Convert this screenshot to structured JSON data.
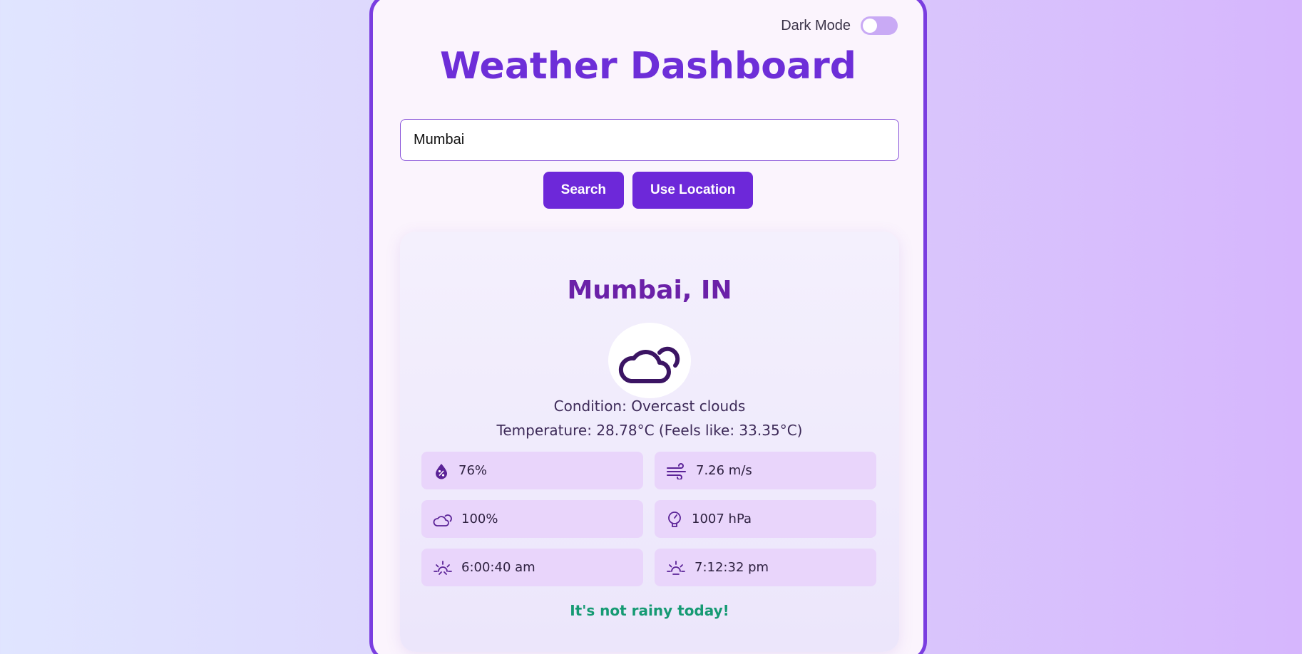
{
  "header": {
    "dark_mode_label": "Dark Mode",
    "dark_mode_on": false,
    "title": "Weather Dashboard"
  },
  "search": {
    "value": "Mumbai",
    "search_button": "Search",
    "location_button": "Use Location"
  },
  "weather": {
    "city": "Mumbai, IN",
    "condition_icon": "cloud-icon",
    "condition": "Condition: Overcast clouds",
    "temperature": "Temperature: 28.78°C (Feels like: 33.35°C)",
    "stats": {
      "humidity": {
        "icon": "humidity-drop-icon",
        "value": "76%"
      },
      "wind": {
        "icon": "wind-icon",
        "value": "7.26 m/s"
      },
      "clouds": {
        "icon": "cloud-icon",
        "value": "100%"
      },
      "pressure": {
        "icon": "pressure-gauge-icon",
        "value": "1007 hPa"
      },
      "sunrise": {
        "icon": "sunrise-icon",
        "value": "6:00:40 am"
      },
      "sunset": {
        "icon": "sunset-icon",
        "value": "7:12:32 pm"
      }
    },
    "rain_message": "It's not rainy today!"
  },
  "colors": {
    "accent": "#6d28d9",
    "title": "#6d2ed8",
    "city": "#6b21a8",
    "stat_bg": "#e9d5fb",
    "rain_message": "#169a73"
  }
}
